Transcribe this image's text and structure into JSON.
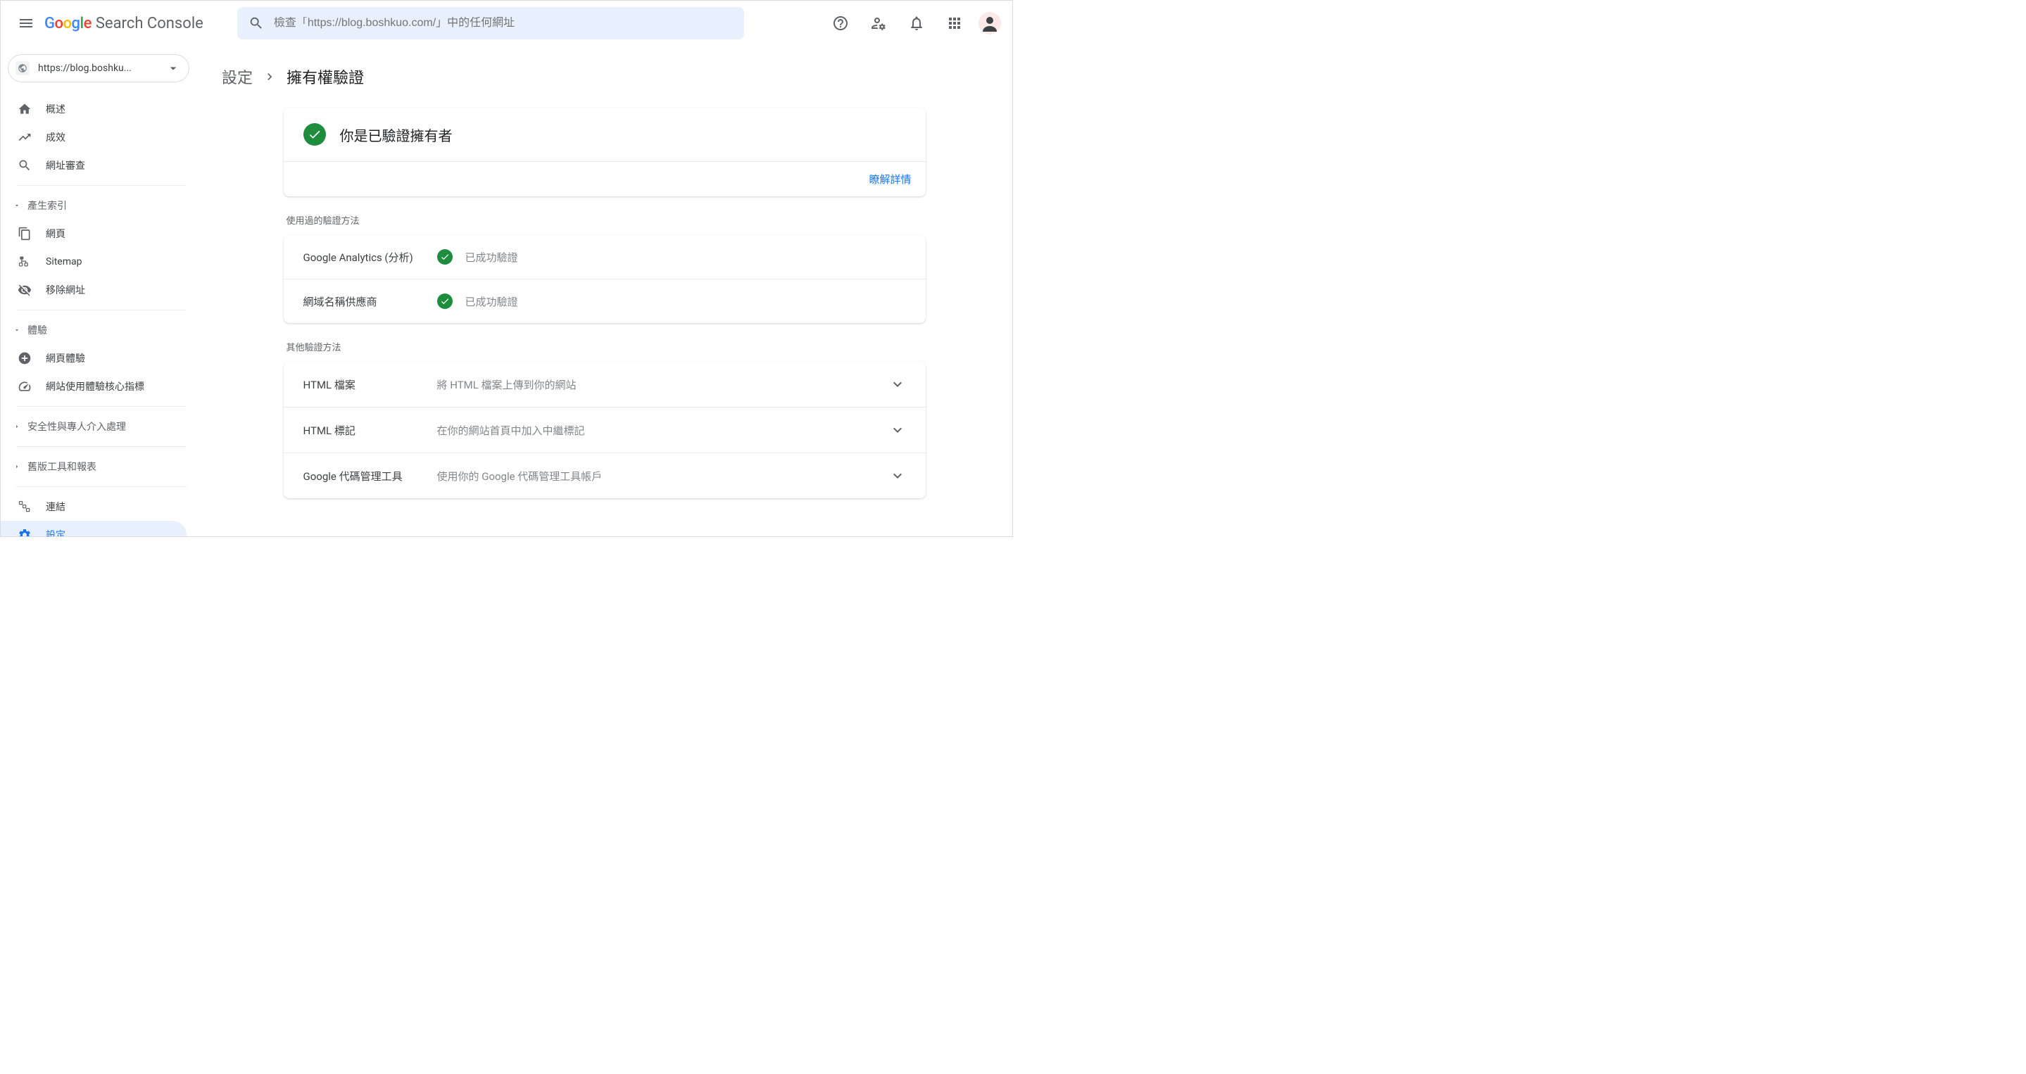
{
  "header": {
    "product_name": "Search Console",
    "search_placeholder": "檢查「https://blog.boshkuo.com/」中的任何網址"
  },
  "property": {
    "url": "https://blog.boshku..."
  },
  "sidebar": {
    "items": [
      {
        "icon": "home",
        "label": "概述"
      },
      {
        "icon": "trending",
        "label": "成效"
      },
      {
        "icon": "search",
        "label": "網址審查"
      }
    ],
    "section_indexing": "產生索引",
    "indexing_items": [
      {
        "icon": "pages",
        "label": "網頁"
      },
      {
        "icon": "sitemap",
        "label": "Sitemap"
      },
      {
        "icon": "remove",
        "label": "移除網址"
      }
    ],
    "section_experience": "體驗",
    "experience_items": [
      {
        "icon": "plus-circle",
        "label": "網頁體驗"
      },
      {
        "icon": "speed",
        "label": "網站使用體驗核心指標"
      }
    ],
    "section_security": "安全性與專人介入處理",
    "section_legacy": "舊版工具和報表",
    "links": "連結",
    "settings": "設定"
  },
  "breadcrumb": {
    "parent": "設定",
    "current": "擁有權驗證"
  },
  "verified_banner": {
    "title": "你是已驗證擁有者",
    "learn_more": "瞭解詳情"
  },
  "used_methods": {
    "label": "使用過的驗證方法",
    "rows": [
      {
        "name": "Google Analytics (分析)",
        "status": "已成功驗證"
      },
      {
        "name": "網域名稱供應商",
        "status": "已成功驗證"
      }
    ]
  },
  "other_methods": {
    "label": "其他驗證方法",
    "rows": [
      {
        "name": "HTML 檔案",
        "desc": "將 HTML 檔案上傳到你的網站"
      },
      {
        "name": "HTML 標記",
        "desc": "在你的網站首頁中加入中繼標記"
      },
      {
        "name": "Google 代碼管理工具",
        "desc": "使用你的 Google 代碼管理工具帳戶"
      }
    ]
  }
}
